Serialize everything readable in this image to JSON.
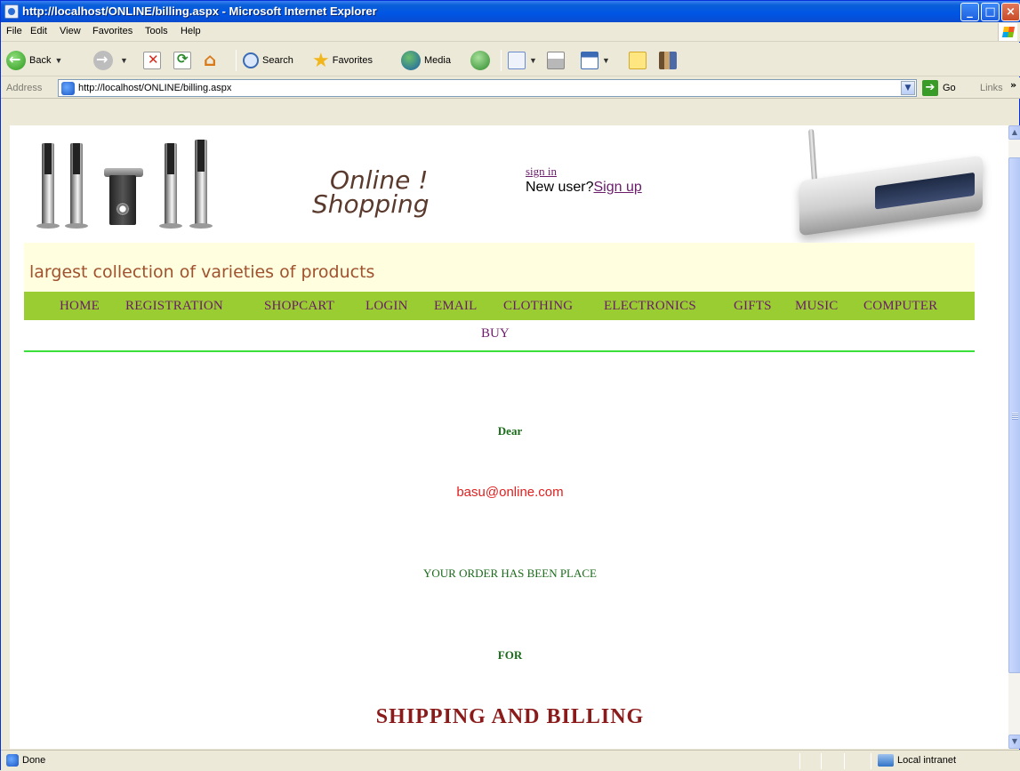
{
  "window": {
    "title": "http://localhost/ONLINE/billing.aspx - Microsoft Internet Explorer"
  },
  "menu": [
    "File",
    "Edit",
    "View",
    "Favorites",
    "Tools",
    "Help"
  ],
  "toolbar": {
    "back": "Back",
    "search": "Search",
    "favorites": "Favorites",
    "media": "Media"
  },
  "address": {
    "label": "Address",
    "url": "http://localhost/ONLINE/billing.aspx",
    "go": "Go",
    "links": "Links"
  },
  "status": {
    "text": "Done",
    "zone": "Local intranet"
  },
  "page": {
    "logo_line1": "Online !",
    "logo_line2": "Shopping",
    "signin": "sign in",
    "newuser_prefix": "New user?",
    "signup": "Sign up",
    "tagline": "largest collection of varieties of products",
    "nav": [
      "HOME",
      "REGISTRATION",
      "SHOPCART",
      "LOGIN",
      "EMAIL",
      "CLOTHING",
      "ELECTRONICS",
      "GIFTS",
      "MUSIC",
      "COMPUTER"
    ],
    "nav_buy": "BUY",
    "dear": "Dear",
    "email": "basu@online.com",
    "order": "YOUR ORDER HAS BEEN PLACE",
    "for": "FOR",
    "shipping": "SHIPPING AND BILLING"
  },
  "colors": {
    "nav_bg": "#9acd32",
    "nav_text": "#6a1b6a",
    "tagline_bg": "#ffffe0",
    "message_green": "#1a6b1a",
    "email_red": "#e02020",
    "shipping_red": "#8b1a1a"
  }
}
